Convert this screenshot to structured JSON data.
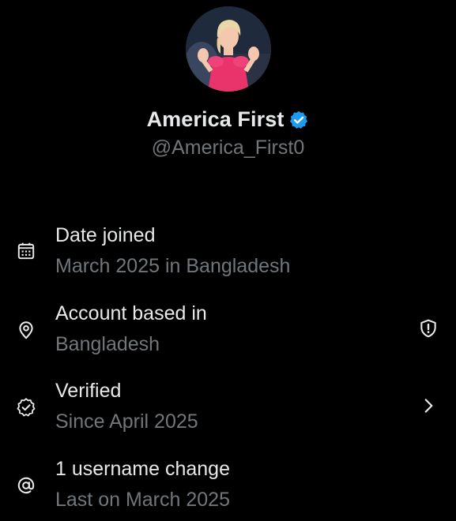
{
  "profile": {
    "display_name": "America First",
    "handle": "@America_First0",
    "verified_color": "#1d9bf0"
  },
  "about": {
    "items": [
      {
        "icon": "calendar-icon",
        "title": "Date joined",
        "subtitle": "March 2025 in Bangladesh"
      },
      {
        "icon": "location-pin-icon",
        "title": "Account based in",
        "subtitle": "Bangladesh",
        "trailing_icon": "shield-alert-icon"
      },
      {
        "icon": "verified-badge-icon",
        "title": "Verified",
        "subtitle": "Since April 2025",
        "trailing_icon": "chevron-right-icon"
      },
      {
        "icon": "at-sign-icon",
        "title": "1 username change",
        "subtitle": "Last on March 2025"
      }
    ]
  },
  "colors": {
    "background": "#000000",
    "primary_text": "#e7e9ea",
    "secondary_text": "#71767b",
    "accent": "#1d9bf0"
  }
}
